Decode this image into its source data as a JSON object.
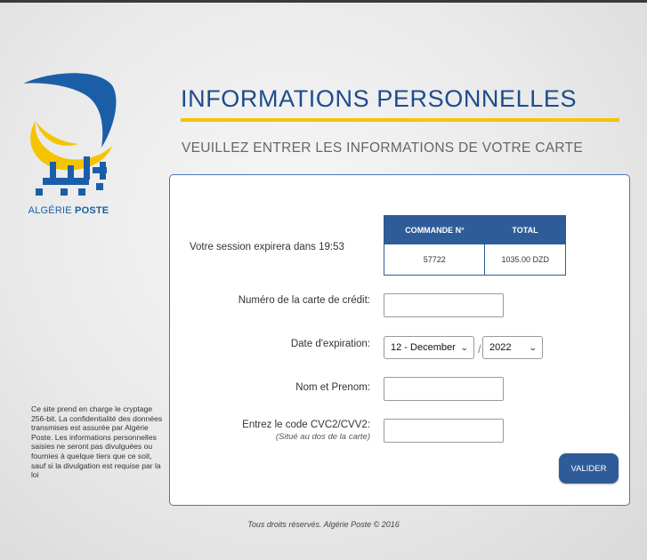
{
  "logo": {
    "brand_prefix": "ALGÉRIE",
    "brand_suffix": "POSTE",
    "colors": {
      "blue": "#1b5ea8",
      "yellow": "#f5c400"
    }
  },
  "header": {
    "title": "INFORMATIONS PERSONNELLES",
    "subtitle": "VEUILLEZ ENTRER LES INFORMATIONS DE VOTRE CARTE"
  },
  "session": {
    "text": "Votre session expirera dans 19:53"
  },
  "order": {
    "col_order": "COMMANDE N°",
    "col_total": "TOTAL",
    "order_number": "57722",
    "total": "1035.00 DZD"
  },
  "form": {
    "card_number_label": "Numéro de la carte de crédit:",
    "card_number_value": "",
    "expiry_label": "Date d'expiration:",
    "expiry_month": "12 - December",
    "expiry_separator": "/",
    "expiry_year": "2022",
    "name_label": "Nom et Prenom:",
    "name_value": "",
    "cvc_label": "Entrez le code CVC2/CVV2:",
    "cvc_note": "(Situé au dos de la carte)",
    "cvc_value": "",
    "submit_label": "VALIDER"
  },
  "security_text": "Ce site prend en charge le cryptage 256-bit. La confidentialité des données transmises est assurée par Algérie Poste. Les informations personnelles saisies ne seront pas divulguées ou fournies à quelque tiers que ce soit, sauf si la divulgation est requise par la loi",
  "footer": "Tous droits réservés. Algérie Poste © 2016",
  "colors": {
    "primary": "#2e5c98",
    "accent": "#f5c400",
    "title": "#1d4c8d"
  }
}
